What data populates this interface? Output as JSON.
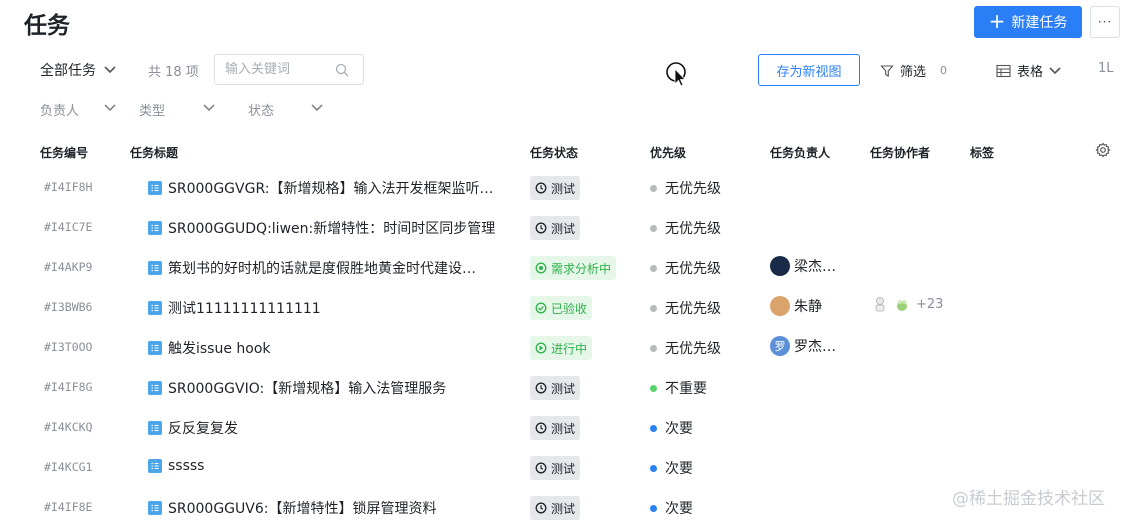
{
  "header": {
    "title": "任务",
    "new_task_label": "新建任务",
    "more_label": "···"
  },
  "toolbar": {
    "scope_label": "全部任务",
    "count_text": "共 18 项",
    "search_placeholder": "输入关键词",
    "save_view_label": "存为新视图",
    "filter_label": "筛选",
    "filter_count": "0",
    "view_label": "表格",
    "sort_label": "1L"
  },
  "sub_filters": {
    "assignee": "负责人",
    "type": "类型",
    "status": "状态"
  },
  "columns": {
    "id": "任务编号",
    "title": "任务标题",
    "status": "任务状态",
    "priority": "优先级",
    "assignee": "任务负责人",
    "collaborators": "任务协作者",
    "tags": "标签"
  },
  "colors": {
    "accent": "#2b7ff6",
    "status_gray_bg": "#e6e7ea",
    "status_green": "#2fb24a",
    "priority_none": "#b7b9bd",
    "priority_low": "#5ad16c",
    "priority_secondary": "#2b7ff6"
  },
  "rows": [
    {
      "id": "#I4IF8H",
      "title": "SR000GGVGR:【新增规格】输入法开发框架监听…",
      "status": "测试",
      "status_kind": "gray",
      "priority": "无优先级",
      "priority_color": "#b7b9bd",
      "assignee": "",
      "collaborators_more": ""
    },
    {
      "id": "#I4IC7E",
      "title": "SR000GGUDQ:liwen:新增特性：时间时区同步管理",
      "status": "测试",
      "status_kind": "gray",
      "priority": "无优先级",
      "priority_color": "#b7b9bd",
      "assignee": "",
      "collaborators_more": ""
    },
    {
      "id": "#I4AKP9",
      "title": "策划书的好时机的话就是度假胜地黄金时代建设…",
      "status": "需求分析中",
      "status_kind": "green",
      "priority": "无优先级",
      "priority_color": "#b7b9bd",
      "assignee": "梁杰…",
      "avatar_color": "#1a2b4a",
      "avatar_text": "",
      "collaborators_more": ""
    },
    {
      "id": "#I3BWB6",
      "title": "测试11111111111111",
      "status": "已验收",
      "status_kind": "green",
      "priority": "无优先级",
      "priority_color": "#b7b9bd",
      "assignee": "朱静",
      "avatar_color": "#d9a36b",
      "avatar_text": "",
      "collaborators_more": "+23"
    },
    {
      "id": "#I3T0OO",
      "title": "触发issue hook",
      "status": "进行中",
      "status_kind": "green",
      "priority": "无优先级",
      "priority_color": "#b7b9bd",
      "assignee": "罗杰…",
      "avatar_color": "#5b8fd6",
      "avatar_text": "罗",
      "collaborators_more": ""
    },
    {
      "id": "#I4IF8G",
      "title": "SR000GGVIO:【新增规格】输入法管理服务",
      "status": "测试",
      "status_kind": "gray",
      "priority": "不重要",
      "priority_color": "#5ad16c",
      "assignee": "",
      "collaborators_more": ""
    },
    {
      "id": "#I4KCKQ",
      "title": "反反复复发",
      "status": "测试",
      "status_kind": "gray",
      "priority": "次要",
      "priority_color": "#2b7ff6",
      "assignee": "",
      "collaborators_more": ""
    },
    {
      "id": "#I4KCG1",
      "title": "sssss",
      "status": "测试",
      "status_kind": "gray",
      "priority": "次要",
      "priority_color": "#2b7ff6",
      "assignee": "",
      "collaborators_more": ""
    },
    {
      "id": "#I4IF8E",
      "title": "SR000GGUV6:【新增特性】锁屏管理资料",
      "status": "测试",
      "status_kind": "gray",
      "priority": "次要",
      "priority_color": "#2b7ff6",
      "assignee": "",
      "collaborators_more": ""
    }
  ],
  "watermark": "@稀土掘金技术社区"
}
